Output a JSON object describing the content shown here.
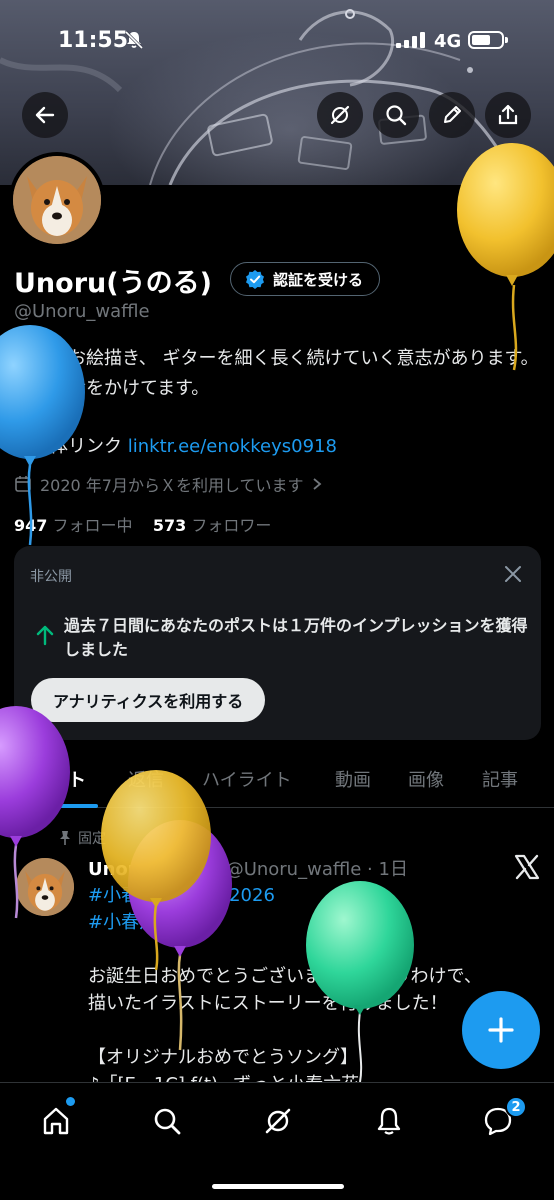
{
  "status": {
    "time": "11:55",
    "network": "4G"
  },
  "header_icons": [
    "back-arrow-icon",
    "grok-icon",
    "search-icon",
    "edit-icon",
    "share-icon"
  ],
  "profile": {
    "name": "Unoru(うのる)",
    "handle": "@Unoru_waffle",
    "verify_label": "認証を受ける",
    "bio": "作曲、お絵描き、 ギターを細く長く続けていく意志があります。 散財に命をかけてます。",
    "link_prefix": "多媒体リンク",
    "link": "linktr.ee/enokkeys0918",
    "joined": "2020 年7月からＸを利用しています",
    "following_count": "947",
    "following_label": "フォロー中",
    "followers_count": "573",
    "followers_label": "フォロワー"
  },
  "private_card": {
    "label": "非公開",
    "message": "過去７日間にあなたのポストは１万件のインプレッションを獲得しました",
    "button": "アナリティクスを利用する"
  },
  "tabs": [
    "ポスト",
    "返信",
    "ハイライト",
    "動画",
    "画像",
    "記事"
  ],
  "post": {
    "pinned_label": "固定",
    "author": "Unoru(うのる)",
    "handle_time": "@Unoru_waffle · 1日",
    "tag1": "#小春六花誕生祭2026",
    "tag2": "#小春六花",
    "line1": "お誕生日おめでとうございます、というわけで、",
    "line2": "描いたイラストにストーリーを付けました！",
    "line3": "【オリジナルおめでとうソング】",
    "line4": "♪「[E - 1C] f(t)=ずっと小春六花"
  },
  "nav": {
    "messages_badge": "2"
  },
  "colors": {
    "accent": "#1d9bf0",
    "background": "#000000",
    "card": "#16181c"
  }
}
